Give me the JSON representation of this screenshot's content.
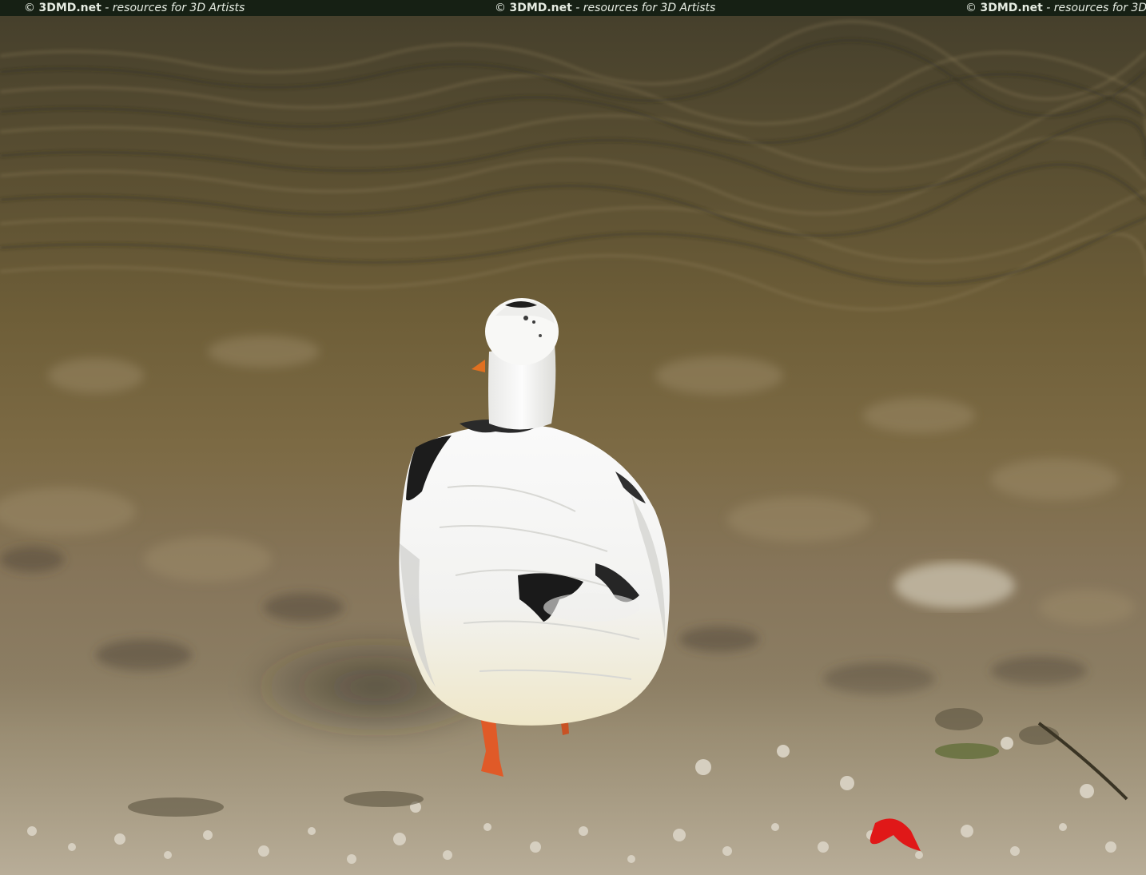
{
  "watermark": {
    "copyright": "©",
    "brand": "3DMD.net",
    "tagline": "- resources for 3D Artists",
    "text_color": "#e6ece2",
    "bar_color": "#162014"
  },
  "scene": {
    "subject": "white duck with black patches",
    "water_color": "#5e5232",
    "shore_color": "#8c7c5c",
    "bill_color": "#e07020",
    "leg_color": "#e05a28",
    "litter_color": "#e01818"
  }
}
